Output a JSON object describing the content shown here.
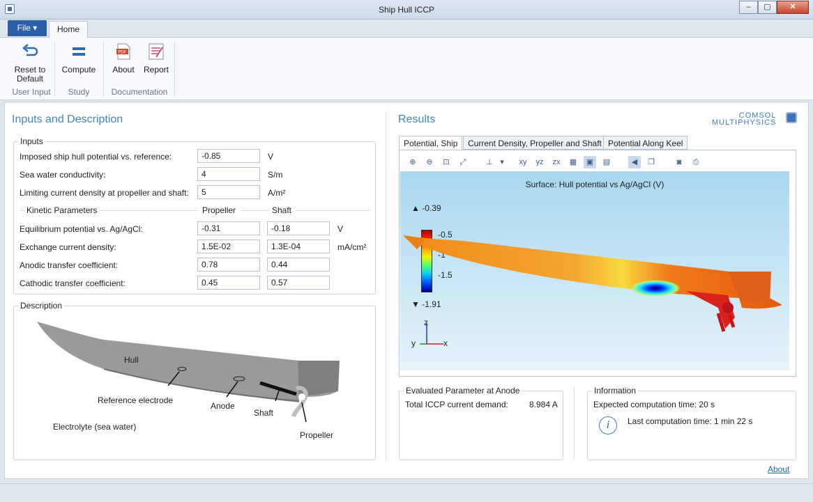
{
  "window": {
    "title": "Ship Hull ICCP"
  },
  "ribbon": {
    "file_label": "File ▾",
    "home_tab": "Home",
    "buttons": {
      "reset": "Reset to\nDefault",
      "compute": "Compute",
      "about": "About",
      "report": "Report"
    },
    "groups": {
      "user_input": "User Input",
      "study": "Study",
      "documentation": "Documentation"
    }
  },
  "left": {
    "title": "Inputs and Description",
    "inputs_legend": "Inputs",
    "rows": [
      {
        "label": "Imposed ship hull potential vs. reference:",
        "value": "-0.85",
        "unit": "V"
      },
      {
        "label": "Sea water conductivity:",
        "value": "4",
        "unit": "S/m"
      },
      {
        "label": "Limiting current density at propeller and shaft:",
        "value": "5",
        "unit": "A/m²"
      }
    ],
    "kinetic": {
      "title": "Kinetic Parameters",
      "col1": "Propeller",
      "col2": "Shaft",
      "rows": [
        {
          "label": "Equilibrium potential vs. Ag/AgCl:",
          "propeller": "-0.31",
          "shaft": "-0.18",
          "unit": "V"
        },
        {
          "label": "Exchange current density:",
          "propeller": "1.5E-02",
          "shaft": "1.3E-04",
          "unit": "mA/cm²"
        },
        {
          "label": "Anodic transfer coefficient:",
          "propeller": "0.78",
          "shaft": "0.44",
          "unit": ""
        },
        {
          "label": "Cathodic transfer coefficient:",
          "propeller": "0.45",
          "shaft": "0.57",
          "unit": ""
        }
      ]
    },
    "description": {
      "legend": "Description",
      "labels": {
        "hull": "Hull",
        "reference_electrode": "Reference  electrode",
        "anode": "Anode",
        "shaft": "Shaft",
        "electrolyte": "Electrolyte (sea  water)",
        "propeller": "Propeller"
      }
    }
  },
  "right": {
    "title": "Results",
    "logo_line1": "COMSOL",
    "logo_line2": "MULTIPHYSICS",
    "tabs": [
      "Potential, Ship",
      "Current Density, Propeller and Shaft",
      "Potential Along Keel"
    ],
    "plot": {
      "title": "Surface: Hull potential vs Ag/AgCl (V)",
      "max_label": "▲ -0.39",
      "min_label": "▼ -1.91",
      "ticks": [
        "-0.5",
        "-1",
        "-1.5"
      ],
      "axis_x": "x",
      "axis_y": "y",
      "axis_z": "z"
    },
    "evaluated": {
      "legend": "Evaluated Parameter at Anode",
      "label": "Total ICCP current demand:",
      "value": "8.984 A"
    },
    "information": {
      "legend": "Information",
      "expected": "Expected computation time: 20 s",
      "last": "Last computation time: 1 min 22 s"
    },
    "about_link": "About"
  },
  "colors": {
    "accent": "#3c87c3",
    "file_tab": "#2b5fa8"
  }
}
